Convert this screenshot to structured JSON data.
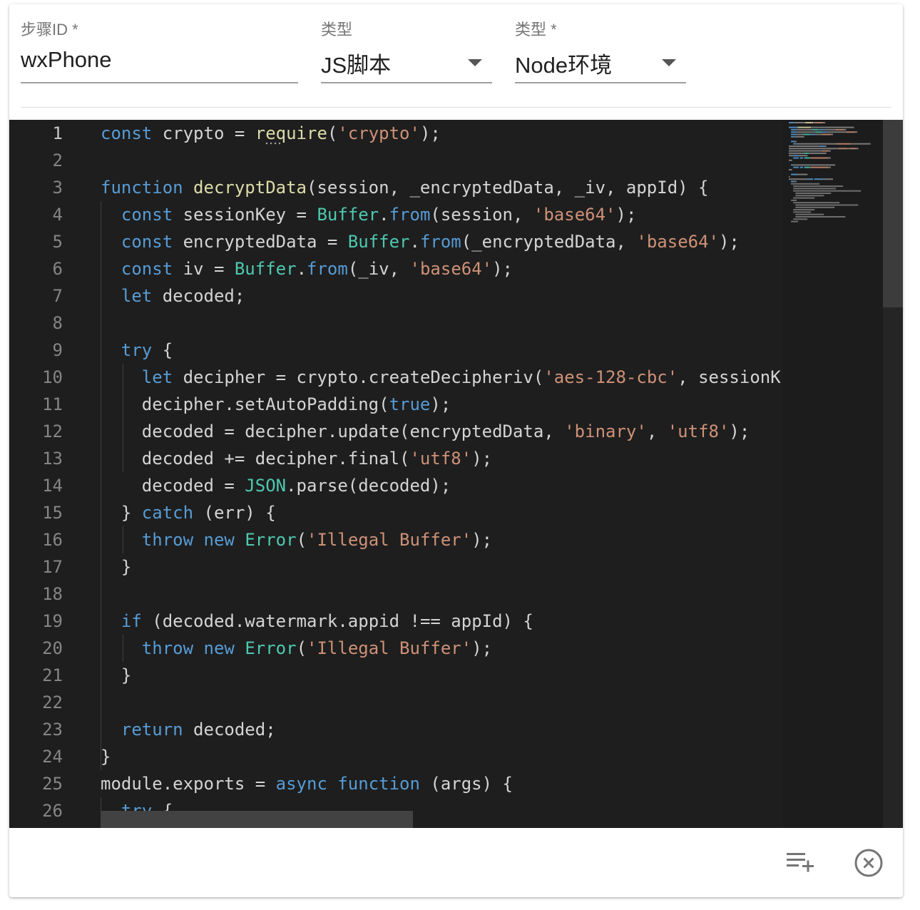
{
  "form": {
    "step_id": {
      "label": "步骤ID *",
      "value": "wxPhone"
    },
    "type": {
      "label": "类型",
      "value": "JS脚本"
    },
    "env": {
      "label": "类型 *",
      "value": "Node环境"
    }
  },
  "editor": {
    "language": "javascript",
    "active_line": 1,
    "lines": [
      [
        [
          "kw",
          "const"
        ],
        [
          "op",
          " crypto = "
        ],
        [
          "fn",
          "require"
        ],
        [
          "op",
          "("
        ],
        [
          "str",
          "'crypto'"
        ],
        [
          "op",
          ");"
        ]
      ],
      [],
      [
        [
          "kw",
          "function"
        ],
        [
          "fn",
          " decryptData"
        ],
        [
          "op",
          "(session, _encryptedData, _iv, appId) {"
        ]
      ],
      [
        [
          "op",
          "  "
        ],
        [
          "kw",
          "const"
        ],
        [
          "op",
          " sessionKey = "
        ],
        [
          "cls",
          "Buffer"
        ],
        [
          "op",
          "."
        ],
        [
          "kw",
          "from"
        ],
        [
          "op",
          "(session, "
        ],
        [
          "str",
          "'base64'"
        ],
        [
          "op",
          ");"
        ]
      ],
      [
        [
          "op",
          "  "
        ],
        [
          "kw",
          "const"
        ],
        [
          "op",
          " encryptedData = "
        ],
        [
          "cls",
          "Buffer"
        ],
        [
          "op",
          "."
        ],
        [
          "kw",
          "from"
        ],
        [
          "op",
          "(_encryptedData, "
        ],
        [
          "str",
          "'base64'"
        ],
        [
          "op",
          ");"
        ]
      ],
      [
        [
          "op",
          "  "
        ],
        [
          "kw",
          "const"
        ],
        [
          "op",
          " iv = "
        ],
        [
          "cls",
          "Buffer"
        ],
        [
          "op",
          "."
        ],
        [
          "kw",
          "from"
        ],
        [
          "op",
          "(_iv, "
        ],
        [
          "str",
          "'base64'"
        ],
        [
          "op",
          ");"
        ]
      ],
      [
        [
          "op",
          "  "
        ],
        [
          "kw",
          "let"
        ],
        [
          "op",
          " decoded;"
        ]
      ],
      [],
      [
        [
          "op",
          "  "
        ],
        [
          "kw",
          "try"
        ],
        [
          "op",
          " {"
        ]
      ],
      [
        [
          "op",
          "    "
        ],
        [
          "kw",
          "let"
        ],
        [
          "op",
          " decipher = crypto.createDecipheriv("
        ],
        [
          "str",
          "'aes-128-cbc'"
        ],
        [
          "op",
          ", sessionKey, iv);"
        ]
      ],
      [
        [
          "op",
          "    decipher.setAutoPadding("
        ],
        [
          "kw",
          "true"
        ],
        [
          "op",
          ");"
        ]
      ],
      [
        [
          "op",
          "    decoded = decipher.update(encryptedData, "
        ],
        [
          "str",
          "'binary'"
        ],
        [
          "op",
          ", "
        ],
        [
          "str",
          "'utf8'"
        ],
        [
          "op",
          ");"
        ]
      ],
      [
        [
          "op",
          "    decoded += decipher.final("
        ],
        [
          "str",
          "'utf8'"
        ],
        [
          "op",
          ");"
        ]
      ],
      [
        [
          "op",
          "    decoded = "
        ],
        [
          "cls",
          "JSON"
        ],
        [
          "op",
          ".parse(decoded);"
        ]
      ],
      [
        [
          "op",
          "  } "
        ],
        [
          "kw",
          "catch"
        ],
        [
          "op",
          " (err) {"
        ]
      ],
      [
        [
          "op",
          "    "
        ],
        [
          "kw",
          "throw"
        ],
        [
          "op",
          " "
        ],
        [
          "kw",
          "new"
        ],
        [
          "op",
          " "
        ],
        [
          "cls",
          "Error"
        ],
        [
          "op",
          "("
        ],
        [
          "str",
          "'Illegal Buffer'"
        ],
        [
          "op",
          ");"
        ]
      ],
      [
        [
          "op",
          "  }"
        ]
      ],
      [],
      [
        [
          "op",
          "  "
        ],
        [
          "kw",
          "if"
        ],
        [
          "op",
          " (decoded.watermark.appid !== appId) {"
        ]
      ],
      [
        [
          "op",
          "    "
        ],
        [
          "kw",
          "throw"
        ],
        [
          "op",
          " "
        ],
        [
          "kw",
          "new"
        ],
        [
          "op",
          " "
        ],
        [
          "cls",
          "Error"
        ],
        [
          "op",
          "("
        ],
        [
          "str",
          "'Illegal Buffer'"
        ],
        [
          "op",
          ");"
        ]
      ],
      [
        [
          "op",
          "  }"
        ]
      ],
      [],
      [
        [
          "op",
          "  "
        ],
        [
          "kw",
          "return"
        ],
        [
          "op",
          " decoded;"
        ]
      ],
      [
        [
          "op",
          "}"
        ]
      ],
      [
        [
          "op",
          "module.exports = "
        ],
        [
          "kw",
          "async"
        ],
        [
          "op",
          " "
        ],
        [
          "kw",
          "function"
        ],
        [
          "op",
          " (args) {"
        ]
      ],
      [
        [
          "op",
          "  "
        ],
        [
          "kw",
          "try"
        ],
        [
          "op",
          " {"
        ]
      ]
    ]
  },
  "footer": {
    "add_icon": "playlist-add-icon",
    "close_icon": "close-circle-icon"
  }
}
